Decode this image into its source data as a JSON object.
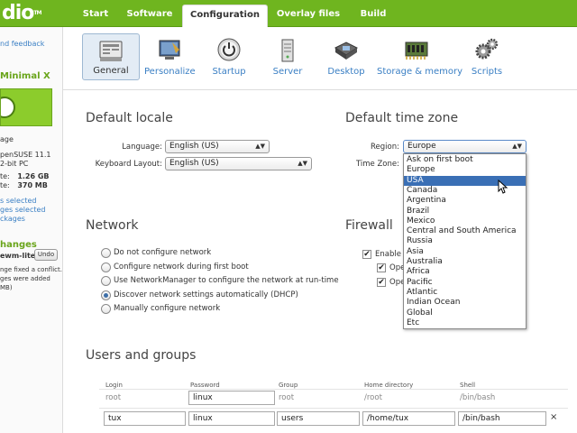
{
  "app": {
    "logo_text": "dio",
    "logo_tm": "TM"
  },
  "top_tabs": [
    {
      "label": "Start"
    },
    {
      "label": "Software"
    },
    {
      "label": "Configuration",
      "active": true
    },
    {
      "label": "Overlay files"
    },
    {
      "label": "Build"
    }
  ],
  "sidebar": {
    "feedback": "nd feedback",
    "appliance_name": "Minimal X",
    "image_label": "age",
    "base": "penSUSE 11.1",
    "arch": "2-bit PC",
    "size_label": "te:",
    "size_value": "1.26 GB",
    "size2_label": "te:",
    "size2_value": "370 MB",
    "selected1": "s selected",
    "selected2": "ges selected",
    "packages": "ckages",
    "changes_title": "hanges",
    "change_item": "ewm-lite",
    "undo_label": "Undo",
    "note1": "nge fixed a conflict.",
    "note2": "ges were added",
    "note3": "MB)"
  },
  "sections": [
    {
      "label": "General",
      "icon": "general-icon",
      "active": true
    },
    {
      "label": "Personalize",
      "icon": "personalize-icon"
    },
    {
      "label": "Startup",
      "icon": "power-icon"
    },
    {
      "label": "Server",
      "icon": "server-icon"
    },
    {
      "label": "Desktop",
      "icon": "desktop-icon"
    },
    {
      "label": "Storage & memory",
      "icon": "storage-icon"
    },
    {
      "label": "Scripts",
      "icon": "gears-icon"
    }
  ],
  "locale": {
    "title": "Default locale",
    "language_label": "Language:",
    "language_value": "English (US)",
    "keyboard_label": "Keyboard Layout:",
    "keyboard_value": "English (US)"
  },
  "timezone": {
    "title": "Default time zone",
    "region_label": "Region:",
    "region_value": "Europe",
    "timezone_label": "Time Zone:",
    "options": [
      "Ask on first boot",
      "Europe",
      "USA",
      "Canada",
      "Argentina",
      "Brazil",
      "Mexico",
      "Central and South America",
      "Russia",
      "Asia",
      "Australia",
      "Africa",
      "Pacific",
      "Atlantic",
      "Indian Ocean",
      "Global",
      "Etc"
    ],
    "highlighted": "USA"
  },
  "network": {
    "title": "Network",
    "options": [
      {
        "label": "Do not configure network",
        "selected": false
      },
      {
        "label": "Configure network during first boot",
        "selected": false
      },
      {
        "label": "Use NetworkManager to configure the network at run-time",
        "selected": false
      },
      {
        "label": "Discover network settings automatically (DHCP)",
        "selected": true
      },
      {
        "label": "Manually configure network",
        "selected": false
      }
    ]
  },
  "firewall": {
    "title": "Firewall",
    "enable_label": "Enable f",
    "open1_label": "Ope",
    "open2_label": "Ope",
    "checkmark": "✔"
  },
  "users": {
    "title": "Users and groups",
    "headers": {
      "login": "Login",
      "password": "Password",
      "group": "Group",
      "home": "Home directory",
      "shell": "Shell"
    },
    "rows": [
      {
        "login": "root",
        "password": "linux",
        "group": "root",
        "home": "/root",
        "shell": "/bin/bash"
      },
      {
        "login": "tux",
        "password": "linux",
        "group": "users",
        "home": "/home/tux",
        "shell": "/bin/bash"
      }
    ],
    "remove_symbol": "×"
  }
}
